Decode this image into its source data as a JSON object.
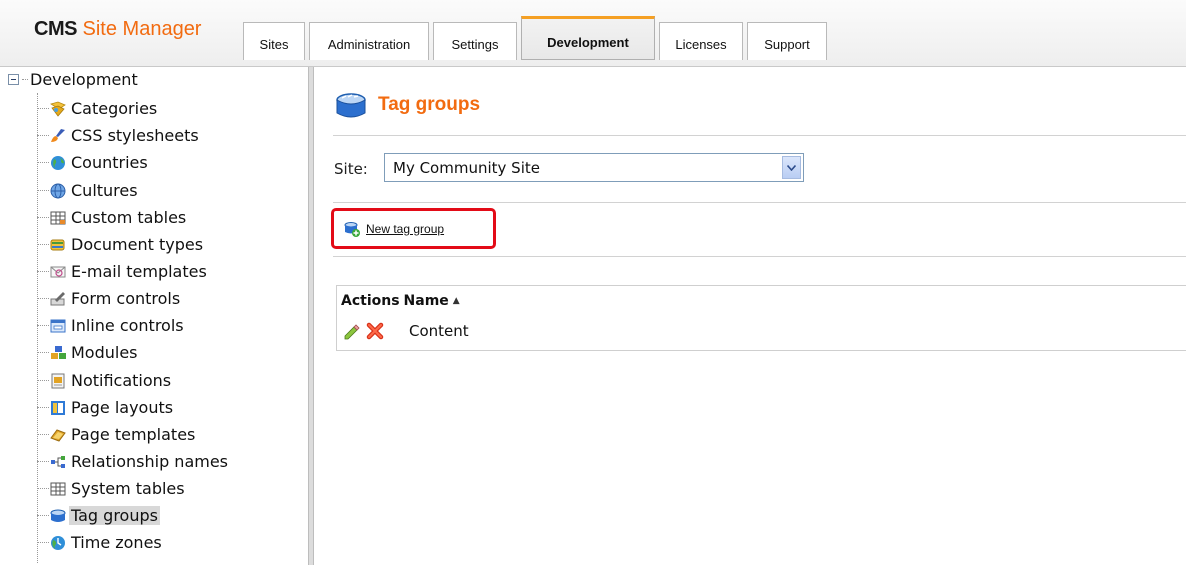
{
  "app": {
    "brand_bold": "CMS",
    "brand_rest": "Site Manager"
  },
  "tabs": [
    {
      "label": "Sites",
      "active": false
    },
    {
      "label": "Administration",
      "active": false
    },
    {
      "label": "Settings",
      "active": false
    },
    {
      "label": "Development",
      "active": true
    },
    {
      "label": "Licenses",
      "active": false
    },
    {
      "label": "Support",
      "active": false
    }
  ],
  "tree": {
    "root_label": "Development",
    "items": [
      {
        "label": "Categories",
        "icon": "categories-icon"
      },
      {
        "label": "CSS stylesheets",
        "icon": "css-brush-icon"
      },
      {
        "label": "Countries",
        "icon": "globe-icon"
      },
      {
        "label": "Cultures",
        "icon": "culture-globe-icon"
      },
      {
        "label": "Custom tables",
        "icon": "table-icon"
      },
      {
        "label": "Document types",
        "icon": "document-stack-icon"
      },
      {
        "label": "E-mail templates",
        "icon": "envelope-icon"
      },
      {
        "label": "Form controls",
        "icon": "form-pencil-icon"
      },
      {
        "label": "Inline controls",
        "icon": "inline-window-icon"
      },
      {
        "label": "Modules",
        "icon": "modules-icon"
      },
      {
        "label": "Notifications",
        "icon": "notification-icon"
      },
      {
        "label": "Page layouts",
        "icon": "page-layout-icon"
      },
      {
        "label": "Page templates",
        "icon": "page-template-icon"
      },
      {
        "label": "Relationship names",
        "icon": "relationship-icon"
      },
      {
        "label": "System tables",
        "icon": "system-table-icon"
      },
      {
        "label": "Tag groups",
        "icon": "tag-group-icon",
        "selected": true
      },
      {
        "label": "Time zones",
        "icon": "clock-globe-icon"
      }
    ]
  },
  "main": {
    "title": "Tag groups",
    "site_label": "Site:",
    "site_value": "My Community Site",
    "new_link": "New tag group",
    "grid": {
      "headers": [
        "Actions",
        "Name"
      ],
      "sort_indicator": "▲",
      "rows": [
        {
          "name": "Content"
        }
      ]
    }
  },
  "colors": {
    "accent": "#f26b10",
    "highlight_box": "#e30b17",
    "active_tab_top": "#f5a024"
  }
}
